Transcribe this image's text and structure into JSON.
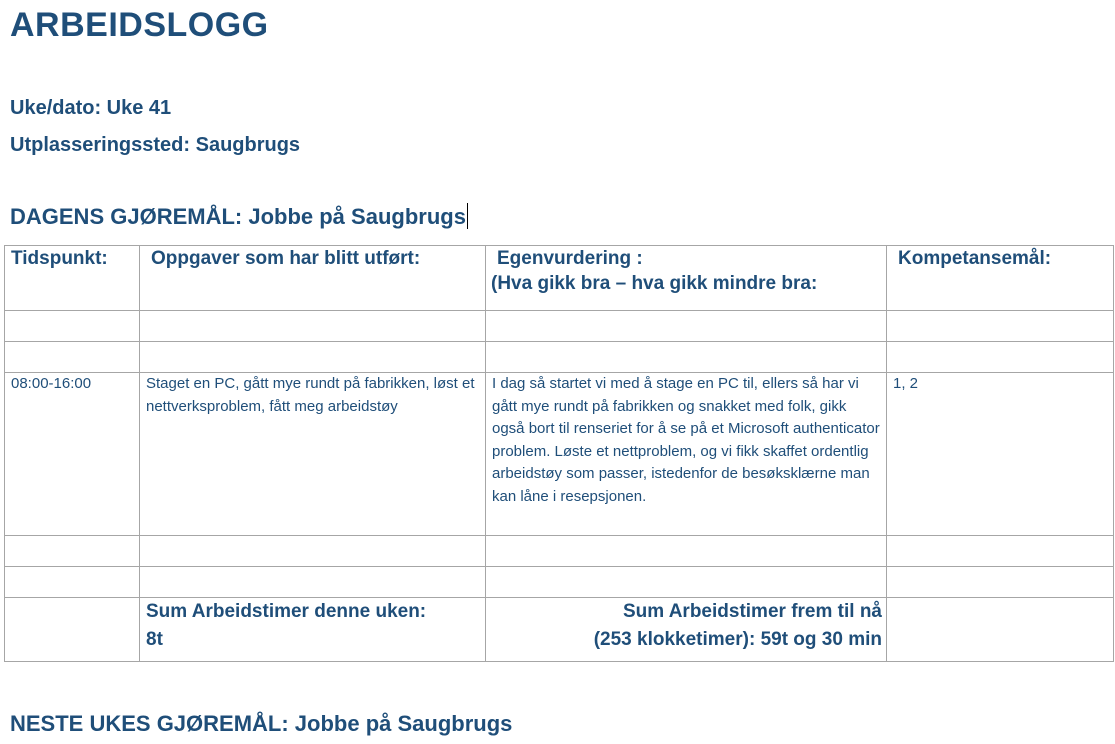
{
  "document": {
    "title": "ARBEIDSLOGG",
    "week_label": "Uke/dato: Uke 41",
    "place_label": "Utplasseringssted: Saugbrugs",
    "today_heading": "DAGENS GJØREMÅL: Jobbe på Saugbrugs",
    "next_heading": "NESTE UKES GJØREMÅL: Jobbe på Saugbrugs"
  },
  "table": {
    "headers": [
      "Tidspunkt:",
      "Oppgaver som har blitt utført:",
      "Egenvurdering :",
      "(Hva gikk bra – hva gikk mindre bra:",
      "Kompetansemål:"
    ],
    "entry": {
      "time": "08:00-16:00",
      "tasks": "Staget en PC, gått mye rundt på fabrikken, løst et nettverksproblem, fått meg arbeidstøy",
      "self_assessment": "I dag så startet vi med å stage en PC til, ellers så har vi gått mye rundt på fabrikken og snakket med folk, gikk også bort til renseriet for å se på et Microsoft authenticator problem. Løste et nettproblem, og vi fikk skaffet ordentlig arbeidstøy som passer, istedenfor de besøksklærne man kan låne i resepsjonen.",
      "goals": "1, 2"
    },
    "sum_week_label": "Sum Arbeidstimer denne uken:",
    "sum_week_value": "8t",
    "sum_total_label": "Sum Arbeidstimer frem til nå",
    "sum_total_value": "(253 klokketimer): 59t og 30 min"
  }
}
